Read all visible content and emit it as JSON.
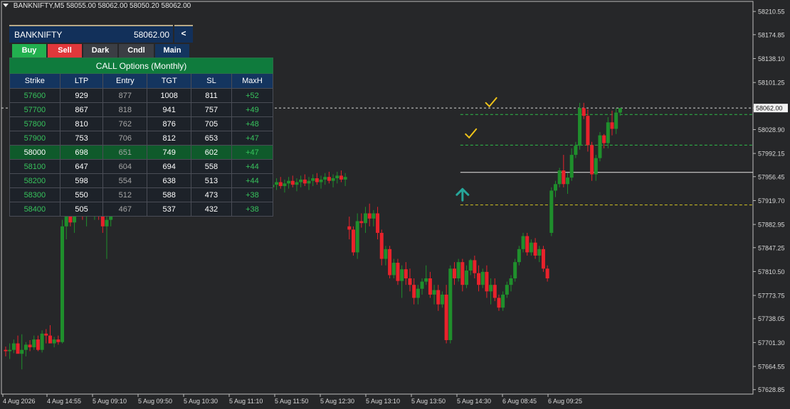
{
  "window": {
    "symbol_timeframe": "BANKNIFTY,M5",
    "ohlc": "58055.00 58062.00 58050.20 58062.00"
  },
  "panel": {
    "symbol": "BANKNIFTY",
    "price": "58062.00",
    "collapse_label": "<",
    "buttons": [
      {
        "label": "Buy",
        "color": "#22b04f"
      },
      {
        "label": "Sell",
        "color": "#e0383b"
      },
      {
        "label": "Dark",
        "color": "#3b3e44"
      },
      {
        "label": "Cndl",
        "color": "#3b3e44"
      },
      {
        "label": "Main",
        "color": "#14355f"
      }
    ],
    "table": {
      "caption": "CALL Options  (Monthly)",
      "columns": [
        "Strike",
        "LTP",
        "Entry",
        "TGT",
        "SL",
        "MaxH"
      ],
      "highlight_strike": "58000",
      "rows": [
        [
          "57600",
          "929",
          "877",
          "1008",
          "811",
          "+52"
        ],
        [
          "57700",
          "867",
          "818",
          "941",
          "757",
          "+49"
        ],
        [
          "57800",
          "810",
          "762",
          "876",
          "705",
          "+48"
        ],
        [
          "57900",
          "753",
          "706",
          "812",
          "653",
          "+47"
        ],
        [
          "58000",
          "698",
          "651",
          "749",
          "602",
          "+47"
        ],
        [
          "58100",
          "647",
          "604",
          "694",
          "558",
          "+44"
        ],
        [
          "58200",
          "598",
          "554",
          "638",
          "513",
          "+44"
        ],
        [
          "58300",
          "550",
          "512",
          "588",
          "473",
          "+38"
        ],
        [
          "58400",
          "505",
          "467",
          "537",
          "432",
          "+38"
        ]
      ]
    }
  },
  "chart_data": {
    "type": "candlestick",
    "y_ticks": [
      "58210.55",
      "58174.85",
      "58138.10",
      "58101.25",
      "58062.00",
      "58028.90",
      "57992.15",
      "57956.45",
      "57919.70",
      "57882.95",
      "57847.25",
      "57810.50",
      "57773.75",
      "57738.05",
      "57701.30",
      "57664.55",
      "57628.85"
    ],
    "x_ticks": [
      "4 Aug 2026",
      "4 Aug 14:55",
      "5 Aug 09:10",
      "5 Aug 09:50",
      "5 Aug 10:30",
      "5 Aug 11:10",
      "5 Aug 11:50",
      "5 Aug 12:30",
      "5 Aug 13:10",
      "5 Aug 13:50",
      "5 Aug 14:30",
      "6 Aug 08:45",
      "6 Aug 09:25"
    ],
    "current_price": "58062.00",
    "ylim": [
      57622,
      58226
    ],
    "levels": [
      {
        "price": 58062,
        "style": "bid",
        "color": "#d8d8d8"
      },
      {
        "price": 58052,
        "style": "target",
        "color": "#2fbf4a"
      },
      {
        "price": 58005,
        "style": "target",
        "color": "#2fbf4a"
      },
      {
        "price": 57963,
        "style": "entry",
        "color": "#e6e6e6"
      },
      {
        "price": 57913,
        "style": "stop",
        "color": "#d6c624"
      }
    ],
    "colors": {
      "bull": "#1f8f2c",
      "bear": "#e8222b",
      "grid": "#3a3b3e",
      "axis_text": "#d8d8d8"
    },
    "markers": [
      {
        "type": "up-arrow",
        "bar": 113,
        "price": 57933,
        "color": "#26a69a"
      },
      {
        "type": "checkmark",
        "bar": 115,
        "price": 58022,
        "color": "#f0c419"
      },
      {
        "type": "checkmark",
        "bar": 120,
        "price": 58070,
        "color": "#f0c419"
      }
    ],
    "candles": [
      [
        57690,
        57695,
        57680,
        57688
      ],
      [
        57688,
        57700,
        57676,
        57690
      ],
      [
        57690,
        57706,
        57685,
        57700
      ],
      [
        57700,
        57712,
        57690,
        57684
      ],
      [
        57684,
        57714,
        57660,
        57690
      ],
      [
        57690,
        57702,
        57680,
        57698
      ],
      [
        57698,
        57705,
        57688,
        57694
      ],
      [
        57694,
        57712,
        57690,
        57706
      ],
      [
        57706,
        57712,
        57688,
        57690
      ],
      [
        57690,
        57720,
        57686,
        57715
      ],
      [
        57715,
        57722,
        57700,
        57712
      ],
      [
        57712,
        57728,
        57708,
        57700
      ],
      [
        57700,
        57710,
        57694,
        57706
      ],
      [
        57706,
        57712,
        57698,
        57702
      ],
      [
        57702,
        57890,
        57700,
        57880
      ],
      [
        57880,
        57920,
        57860,
        57905
      ],
      [
        57905,
        57915,
        57880,
        57886
      ],
      [
        57886,
        57930,
        57870,
        57920
      ],
      [
        57920,
        57930,
        57900,
        57908
      ],
      [
        57908,
        57920,
        57890,
        57895
      ],
      [
        57895,
        57915,
        57880,
        57910
      ],
      [
        57910,
        57925,
        57895,
        57902
      ],
      [
        57902,
        57920,
        57890,
        57915
      ],
      [
        57915,
        57920,
        57890,
        57898
      ],
      [
        57898,
        57905,
        57870,
        57880
      ],
      [
        57880,
        57895,
        57830,
        57890
      ],
      [
        57890,
        57940,
        57880,
        57930
      ],
      [
        57930,
        57942,
        57912,
        57920
      ],
      [
        57920,
        57932,
        57905,
        57928
      ],
      [
        57928,
        57935,
        57910,
        57915
      ],
      [
        57915,
        57930,
        57905,
        57922
      ],
      [
        57922,
        57930,
        57900,
        57908
      ],
      [
        57908,
        57918,
        57895,
        57912
      ],
      [
        57912,
        57925,
        57905,
        57918
      ],
      [
        57918,
        57928,
        57908,
        57910
      ],
      [
        57910,
        57922,
        57898,
        57916
      ],
      [
        57916,
        57928,
        57905,
        57920
      ],
      [
        57920,
        57935,
        57910,
        57928
      ],
      [
        57928,
        57940,
        57915,
        57920
      ],
      [
        57920,
        57932,
        57908,
        57926
      ],
      [
        57926,
        57938,
        57918,
        57930
      ],
      [
        57930,
        57940,
        57920,
        57925
      ],
      [
        57925,
        57935,
        57912,
        57930
      ],
      [
        57930,
        57942,
        57922,
        57936
      ],
      [
        57936,
        57945,
        57925,
        57928
      ],
      [
        57928,
        57938,
        57915,
        57932
      ],
      [
        57932,
        57944,
        57922,
        57938
      ],
      [
        57938,
        57946,
        57928,
        57930
      ],
      [
        57930,
        57940,
        57918,
        57935
      ],
      [
        57935,
        57945,
        57925,
        57940
      ],
      [
        57940,
        57948,
        57928,
        57932
      ],
      [
        57932,
        57942,
        57920,
        57936
      ],
      [
        57936,
        57946,
        57928,
        57940
      ],
      [
        57940,
        57950,
        57930,
        57934
      ],
      [
        57934,
        57944,
        57922,
        57938
      ],
      [
        57938,
        57948,
        57930,
        57942
      ],
      [
        57942,
        57950,
        57932,
        57936
      ],
      [
        57936,
        57946,
        57926,
        57940
      ],
      [
        57940,
        57950,
        57930,
        57944
      ],
      [
        57944,
        57952,
        57932,
        57936
      ],
      [
        57936,
        57946,
        57924,
        57940
      ],
      [
        57940,
        57950,
        57930,
        57944
      ],
      [
        57944,
        57952,
        57934,
        57938
      ],
      [
        57938,
        57948,
        57928,
        57942
      ],
      [
        57942,
        57952,
        57932,
        57946
      ],
      [
        57946,
        57955,
        57936,
        57940
      ],
      [
        57940,
        57950,
        57930,
        57944
      ],
      [
        57944,
        57954,
        57936,
        57948
      ],
      [
        57948,
        57956,
        57938,
        57942
      ],
      [
        57942,
        57952,
        57932,
        57946
      ],
      [
        57946,
        57956,
        57938,
        57950
      ],
      [
        57950,
        57958,
        57940,
        57944
      ],
      [
        57944,
        57954,
        57934,
        57948
      ],
      [
        57948,
        57958,
        57940,
        57952
      ],
      [
        57952,
        57960,
        57942,
        57946
      ],
      [
        57946,
        57956,
        57936,
        57950
      ],
      [
        57950,
        57960,
        57942,
        57954
      ],
      [
        57954,
        57962,
        57944,
        57948
      ],
      [
        57948,
        57958,
        57938,
        57952
      ],
      [
        57952,
        57962,
        57944,
        57956
      ],
      [
        57956,
        57964,
        57946,
        57950
      ],
      [
        57950,
        57960,
        57940,
        57954
      ],
      [
        57954,
        57964,
        57946,
        57958
      ],
      [
        57958,
        57966,
        57948,
        57952
      ],
      [
        57952,
        57962,
        57942,
        57956
      ],
      [
        57880,
        57895,
        57860,
        57875
      ],
      [
        57875,
        57880,
        57835,
        57840
      ],
      [
        57840,
        57900,
        57830,
        57888
      ],
      [
        57888,
        57900,
        57878,
        57885
      ],
      [
        57885,
        57910,
        57870,
        57900
      ],
      [
        57900,
        57915,
        57880,
        57892
      ],
      [
        57892,
        57905,
        57880,
        57900
      ],
      [
        57900,
        57910,
        57860,
        57870
      ],
      [
        57870,
        57875,
        57820,
        57830
      ],
      [
        57830,
        57850,
        57820,
        57845
      ],
      [
        57845,
        57850,
        57800,
        57805
      ],
      [
        57805,
        57830,
        57800,
        57824
      ],
      [
        57824,
        57830,
        57790,
        57796
      ],
      [
        57796,
        57820,
        57770,
        57814
      ],
      [
        57814,
        57825,
        57790,
        57800
      ],
      [
        57800,
        57815,
        57780,
        57790
      ],
      [
        57790,
        57800,
        57760,
        57770
      ],
      [
        57770,
        57790,
        57760,
        57784
      ],
      [
        57784,
        57800,
        57775,
        57795
      ],
      [
        57795,
        57820,
        57790,
        57800
      ],
      [
        57800,
        57810,
        57770,
        57775
      ],
      [
        57775,
        57790,
        57760,
        57782
      ],
      [
        57782,
        57790,
        57750,
        57760
      ],
      [
        57760,
        57780,
        57755,
        57775
      ],
      [
        57775,
        57790,
        57700,
        57705
      ],
      [
        57705,
        57820,
        57700,
        57815
      ],
      [
        57815,
        57825,
        57790,
        57800
      ],
      [
        57800,
        57830,
        57795,
        57825
      ],
      [
        57825,
        57830,
        57780,
        57790
      ],
      [
        57790,
        57820,
        57785,
        57812
      ],
      [
        57812,
        57830,
        57805,
        57828
      ],
      [
        57828,
        57835,
        57800,
        57808
      ],
      [
        57808,
        57820,
        57780,
        57790
      ],
      [
        57790,
        57815,
        57785,
        57810
      ],
      [
        57810,
        57820,
        57770,
        57780
      ],
      [
        57780,
        57800,
        57760,
        57790
      ],
      [
        57790,
        57800,
        57765,
        57770
      ],
      [
        57770,
        57775,
        57750,
        57755
      ],
      [
        57755,
        57780,
        57750,
        57775
      ],
      [
        57775,
        57795,
        57770,
        57790
      ],
      [
        57790,
        57805,
        57780,
        57800
      ],
      [
        57800,
        57830,
        57795,
        57825
      ],
      [
        57825,
        57850,
        57820,
        57845
      ],
      [
        57845,
        57870,
        57840,
        57865
      ],
      [
        57865,
        57870,
        57835,
        57840
      ],
      [
        57840,
        57860,
        57835,
        57855
      ],
      [
        57855,
        57862,
        57830,
        57835
      ],
      [
        57835,
        57850,
        57825,
        57845
      ],
      [
        57845,
        57850,
        57810,
        57815
      ],
      [
        57815,
        57820,
        57795,
        57800
      ],
      [
        57870,
        57940,
        57865,
        57935
      ],
      [
        57935,
        57950,
        57925,
        57945
      ],
      [
        57945,
        57970,
        57940,
        57966
      ],
      [
        57966,
        57990,
        57940,
        57945
      ],
      [
        57945,
        57962,
        57930,
        57955
      ],
      [
        57955,
        58000,
        57950,
        57990
      ],
      [
        57990,
        58010,
        57985,
        58004
      ],
      [
        58004,
        58070,
        57998,
        58062
      ],
      [
        58062,
        58070,
        58045,
        58050
      ],
      [
        58050,
        58060,
        57995,
        58005
      ],
      [
        58005,
        58010,
        57950,
        57960
      ],
      [
        57960,
        57990,
        57950,
        57985
      ],
      [
        57985,
        58025,
        57980,
        58020
      ],
      [
        58020,
        58022,
        58000,
        58008
      ],
      [
        58008,
        58048,
        58000,
        58040
      ],
      [
        58040,
        58058,
        58020,
        58030
      ],
      [
        58030,
        58062,
        58022,
        58055
      ],
      [
        58055,
        58062,
        58050,
        58062
      ]
    ]
  }
}
